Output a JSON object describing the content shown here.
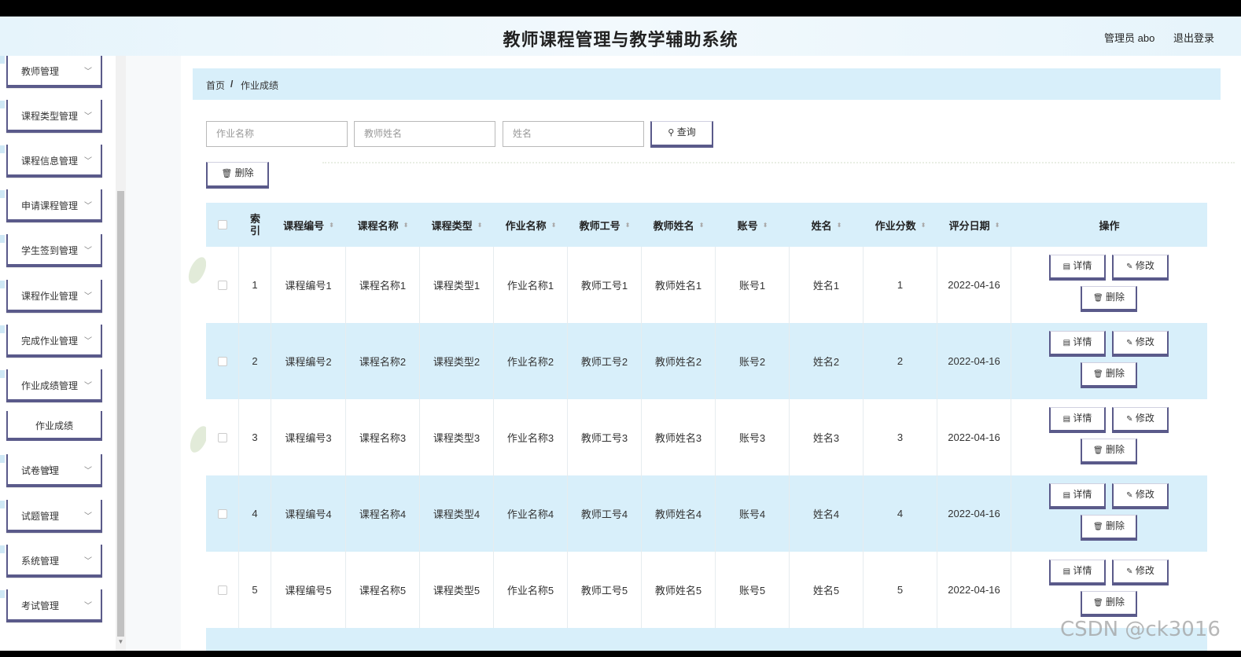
{
  "header": {
    "title": "教师课程管理与教学辅助系统",
    "user": "管理员 abo",
    "logout": "退出登录"
  },
  "sidebar": {
    "items": [
      {
        "label": "教师管理"
      },
      {
        "label": "课程类型管理"
      },
      {
        "label": "课程信息管理"
      },
      {
        "label": "申请课程管理"
      },
      {
        "label": "学生签到管理"
      },
      {
        "label": "课程作业管理"
      },
      {
        "label": "完成作业管理"
      },
      {
        "label": "作业成绩管理"
      },
      {
        "label": "试卷管理"
      },
      {
        "label": "试题管理"
      },
      {
        "label": "系统管理"
      },
      {
        "label": "考试管理"
      }
    ],
    "submenu": {
      "label": "作业成绩"
    }
  },
  "breadcrumb": {
    "home": "首页",
    "sep": "/",
    "current": "作业成绩"
  },
  "search": {
    "homework_placeholder": "作业名称",
    "teacher_placeholder": "教师姓名",
    "name_placeholder": "姓名",
    "query_label": "查询",
    "delete_label": "删除"
  },
  "table": {
    "headers": [
      "索引",
      "课程编号",
      "课程名称",
      "课程类型",
      "作业名称",
      "教师工号",
      "教师姓名",
      "账号",
      "姓名",
      "作业分数",
      "评分日期",
      "操作"
    ],
    "rows": [
      {
        "index": "1",
        "course_no": "课程编号1",
        "course_name": "课程名称1",
        "course_type": "课程类型1",
        "hw_name": "作业名称1",
        "teacher_no": "教师工号1",
        "teacher_name": "教师姓名1",
        "account": "账号1",
        "name": "姓名1",
        "score": "1",
        "date": "2022-04-16"
      },
      {
        "index": "2",
        "course_no": "课程编号2",
        "course_name": "课程名称2",
        "course_type": "课程类型2",
        "hw_name": "作业名称2",
        "teacher_no": "教师工号2",
        "teacher_name": "教师姓名2",
        "account": "账号2",
        "name": "姓名2",
        "score": "2",
        "date": "2022-04-16"
      },
      {
        "index": "3",
        "course_no": "课程编号3",
        "course_name": "课程名称3",
        "course_type": "课程类型3",
        "hw_name": "作业名称3",
        "teacher_no": "教师工号3",
        "teacher_name": "教师姓名3",
        "account": "账号3",
        "name": "姓名3",
        "score": "3",
        "date": "2022-04-16"
      },
      {
        "index": "4",
        "course_no": "课程编号4",
        "course_name": "课程名称4",
        "course_type": "课程类型4",
        "hw_name": "作业名称4",
        "teacher_no": "教师工号4",
        "teacher_name": "教师姓名4",
        "account": "账号4",
        "name": "姓名4",
        "score": "4",
        "date": "2022-04-16"
      },
      {
        "index": "5",
        "course_no": "课程编号5",
        "course_name": "课程名称5",
        "course_type": "课程类型5",
        "hw_name": "作业名称5",
        "teacher_no": "教师工号5",
        "teacher_name": "教师姓名5",
        "account": "账号5",
        "name": "姓名5",
        "score": "5",
        "date": "2022-04-16"
      }
    ],
    "actions": {
      "detail": "详情",
      "edit": "修改",
      "delete": "删除"
    }
  },
  "watermark": "CSDN @ck3016",
  "icons": {
    "search": "search-icon",
    "trash": "trash-icon",
    "doc": "document-icon",
    "pencil": "pencil-icon",
    "chevron": "chevron-down-icon"
  }
}
